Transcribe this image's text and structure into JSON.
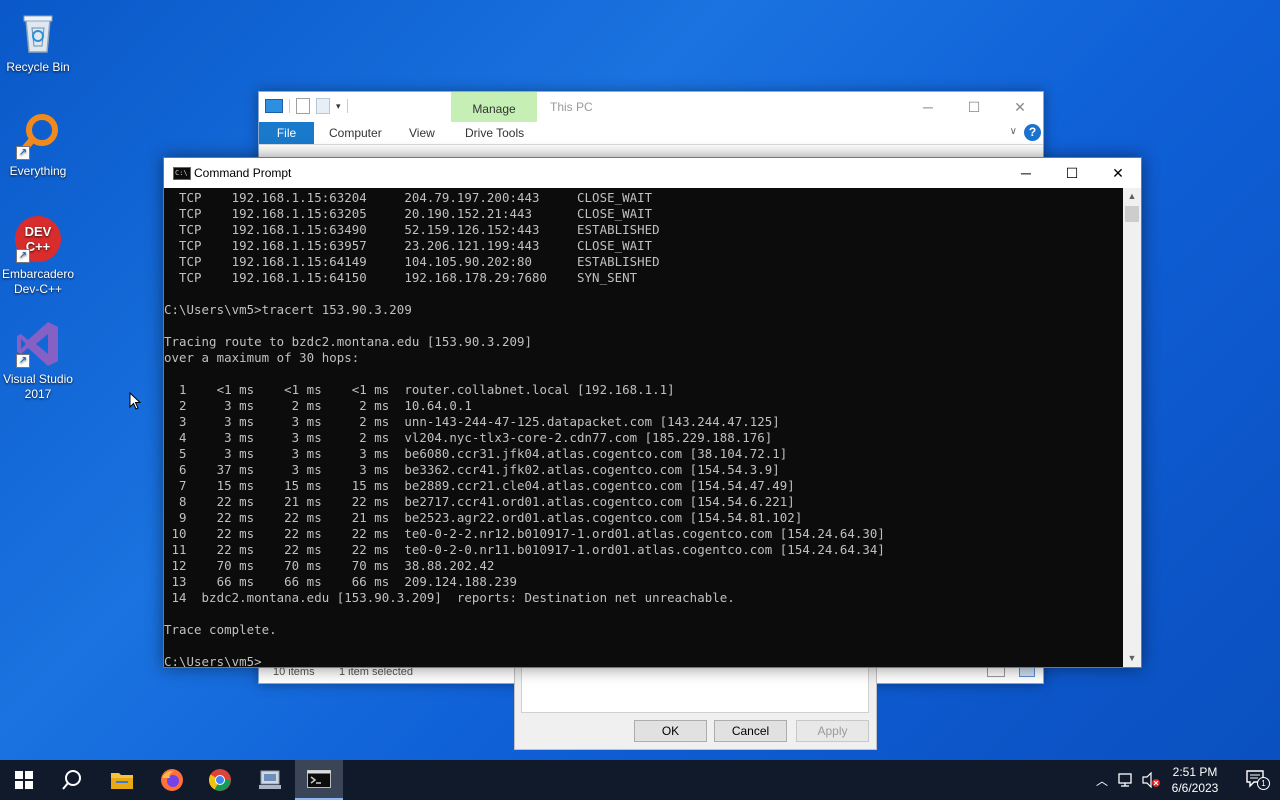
{
  "desktop": {
    "icons": [
      {
        "label": "Recycle Bin",
        "icon": "recycle-bin-icon"
      },
      {
        "label": "Everything",
        "icon": "everything-search-icon"
      },
      {
        "label": "Embarcadero Dev-C++",
        "icon": "devcpp-icon",
        "badge": "DEV C++"
      },
      {
        "label": "Visual Studio 2017",
        "icon": "visual-studio-icon"
      }
    ]
  },
  "explorer": {
    "title": "This PC",
    "contextual_tab": "Manage",
    "tabs": [
      "File",
      "Computer",
      "View",
      "Drive Tools"
    ],
    "status_items": "10 items",
    "status_selected": "1 item selected"
  },
  "properties_dialog": {
    "buttons": {
      "ok": "OK",
      "cancel": "Cancel",
      "apply": "Apply"
    }
  },
  "cmd": {
    "title": "Command Prompt",
    "lines": [
      "  TCP    192.168.1.15:63204     204.79.197.200:443     CLOSE_WAIT",
      "  TCP    192.168.1.15:63205     20.190.152.21:443      CLOSE_WAIT",
      "  TCP    192.168.1.15:63490     52.159.126.152:443     ESTABLISHED",
      "  TCP    192.168.1.15:63957     23.206.121.199:443     CLOSE_WAIT",
      "  TCP    192.168.1.15:64149     104.105.90.202:80      ESTABLISHED",
      "  TCP    192.168.1.15:64150     192.168.178.29:7680    SYN_SENT",
      "",
      "C:\\Users\\vm5>tracert 153.90.3.209",
      "",
      "Tracing route to bzdc2.montana.edu [153.90.3.209]",
      "over a maximum of 30 hops:",
      "",
      "  1    <1 ms    <1 ms    <1 ms  router.collabnet.local [192.168.1.1]",
      "  2     3 ms     2 ms     2 ms  10.64.0.1",
      "  3     3 ms     3 ms     2 ms  unn-143-244-47-125.datapacket.com [143.244.47.125]",
      "  4     3 ms     3 ms     2 ms  vl204.nyc-tlx3-core-2.cdn77.com [185.229.188.176]",
      "  5     3 ms     3 ms     3 ms  be6080.ccr31.jfk04.atlas.cogentco.com [38.104.72.1]",
      "  6    37 ms     3 ms     3 ms  be3362.ccr41.jfk02.atlas.cogentco.com [154.54.3.9]",
      "  7    15 ms    15 ms    15 ms  be2889.ccr21.cle04.atlas.cogentco.com [154.54.47.49]",
      "  8    22 ms    21 ms    22 ms  be2717.ccr41.ord01.atlas.cogentco.com [154.54.6.221]",
      "  9    22 ms    22 ms    21 ms  be2523.agr22.ord01.atlas.cogentco.com [154.54.81.102]",
      " 10    22 ms    22 ms    22 ms  te0-0-2-2.nr12.b010917-1.ord01.atlas.cogentco.com [154.24.64.30]",
      " 11    22 ms    22 ms    22 ms  te0-0-2-0.nr11.b010917-1.ord01.atlas.cogentco.com [154.24.64.34]",
      " 12    70 ms    70 ms    70 ms  38.88.202.42",
      " 13    66 ms    66 ms    66 ms  209.124.188.239",
      " 14  bzdc2.montana.edu [153.90.3.209]  reports: Destination net unreachable.",
      "",
      "Trace complete.",
      "",
      "C:\\Users\\vm5>"
    ]
  },
  "taskbar": {
    "items": [
      "start-icon",
      "search-icon",
      "file-explorer-icon",
      "firefox-icon",
      "chrome-icon",
      "network-tool-icon",
      "command-prompt-icon"
    ],
    "active": "command-prompt-icon",
    "time": "2:51 PM",
    "date": "6/6/2023",
    "notification_count": "1"
  }
}
